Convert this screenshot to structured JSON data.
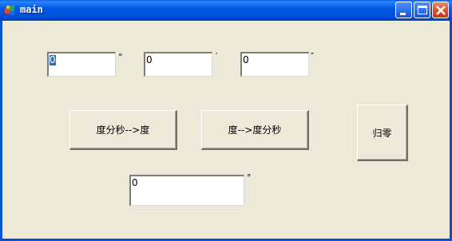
{
  "window": {
    "title": "main"
  },
  "inputs": {
    "degrees": {
      "value": "0",
      "unit": "°"
    },
    "minutes": {
      "value": "0",
      "unit": "′"
    },
    "seconds": {
      "value": "0",
      "unit": "″"
    },
    "result": {
      "value": "0",
      "unit": "°"
    }
  },
  "buttons": {
    "dms_to_deg": "度分秒-->度",
    "deg_to_dms": "度-->度分秒",
    "reset": "归零"
  },
  "icons": {
    "app": "app-icon",
    "minimize": "minimize-icon",
    "maximize": "maximize-icon",
    "close": "close-icon"
  }
}
